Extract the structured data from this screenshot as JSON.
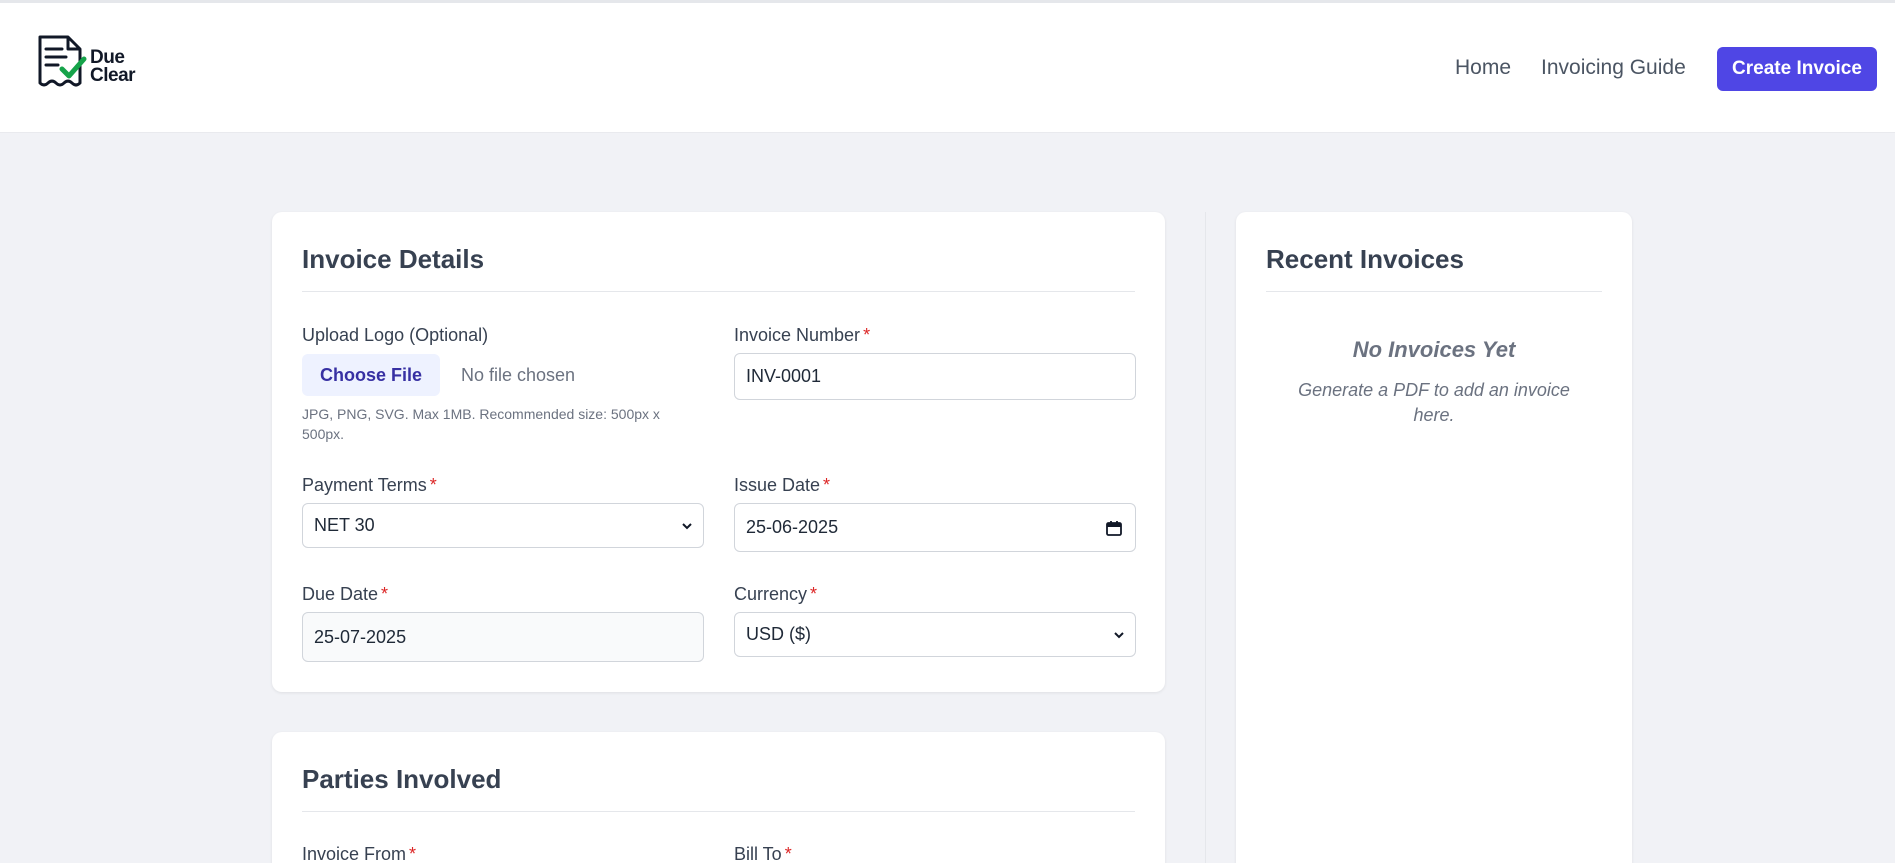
{
  "header": {
    "logo_line1": "Due",
    "logo_line2": "Clear",
    "nav": {
      "home": "Home",
      "guide": "Invoicing Guide"
    },
    "cta": "Create Invoice"
  },
  "invoice_details": {
    "title": "Invoice Details",
    "logo_label": "Upload Logo (Optional)",
    "choose_file": "Choose File",
    "file_status": "No file chosen",
    "file_hint": "JPG, PNG, SVG. Max 1MB. Recommended size: 500px x 500px.",
    "invoice_number_label": "Invoice Number",
    "invoice_number": "INV-0001",
    "payment_terms_label": "Payment Terms",
    "payment_terms": "NET 30",
    "issue_date_label": "Issue Date",
    "issue_date": "25-06-2025",
    "due_date_label": "Due Date",
    "due_date": "25-07-2025",
    "currency_label": "Currency",
    "currency": "USD ($)",
    "required_mark": "*"
  },
  "parties": {
    "title": "Parties Involved",
    "from_label": "Invoice From",
    "to_label": "Bill To"
  },
  "recent": {
    "title": "Recent Invoices",
    "empty_title": "No Invoices Yet",
    "empty_sub": "Generate a PDF to add an invoice here."
  },
  "colors": {
    "accent": "#4f46e5",
    "required": "#dc2626",
    "check_green": "#16a34a"
  }
}
